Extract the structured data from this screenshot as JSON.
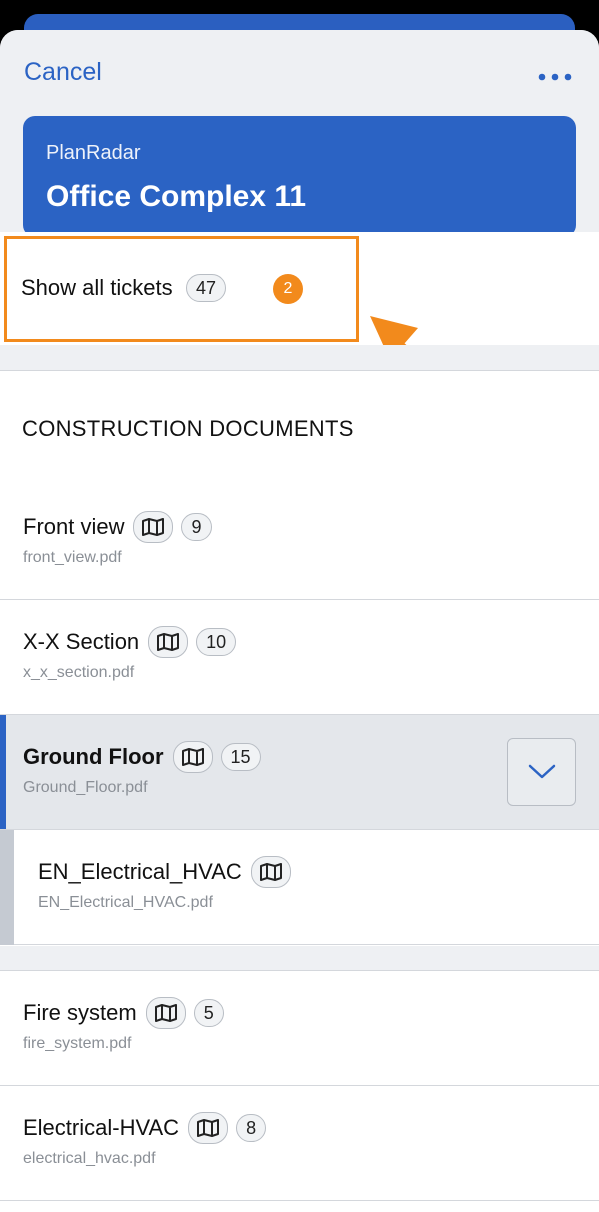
{
  "header": {
    "cancel_label": "Cancel",
    "more_icon": "more-dots-icon",
    "organization": "PlanRadar",
    "project_name": "Office Complex 11"
  },
  "show_all": {
    "label": "Show all tickets",
    "count": "47"
  },
  "tutorial": {
    "step_number": "2",
    "highlight_color": "#f28a1c"
  },
  "section": {
    "title": "CONSTRUCTION DOCUMENTS"
  },
  "documents": [
    {
      "title": "Front view",
      "file": "front_view.pdf",
      "count": "9",
      "icon": "map-icon"
    },
    {
      "title": "X-X Section",
      "file": "x_x_section.pdf",
      "count": "10",
      "icon": "map-icon"
    },
    {
      "title": "Ground Floor",
      "file": "Ground_Floor.pdf",
      "count": "15",
      "icon": "map-icon",
      "selected": true,
      "expand_icon": "chevron-down-icon"
    },
    {
      "title": "EN_Electrical_HVAC",
      "file": "EN_Electrical_HVAC.pdf",
      "icon": "map-icon",
      "child": true
    },
    {
      "title": "Fire system",
      "file": "fire_system.pdf",
      "count": "5",
      "icon": "map-icon"
    },
    {
      "title": "Electrical-HVAC",
      "file": "electrical_hvac.pdf",
      "count": "8",
      "icon": "map-icon"
    }
  ],
  "colors": {
    "accent": "#2b63c4",
    "background": "#eef0f3",
    "highlight": "#f28a1c"
  }
}
